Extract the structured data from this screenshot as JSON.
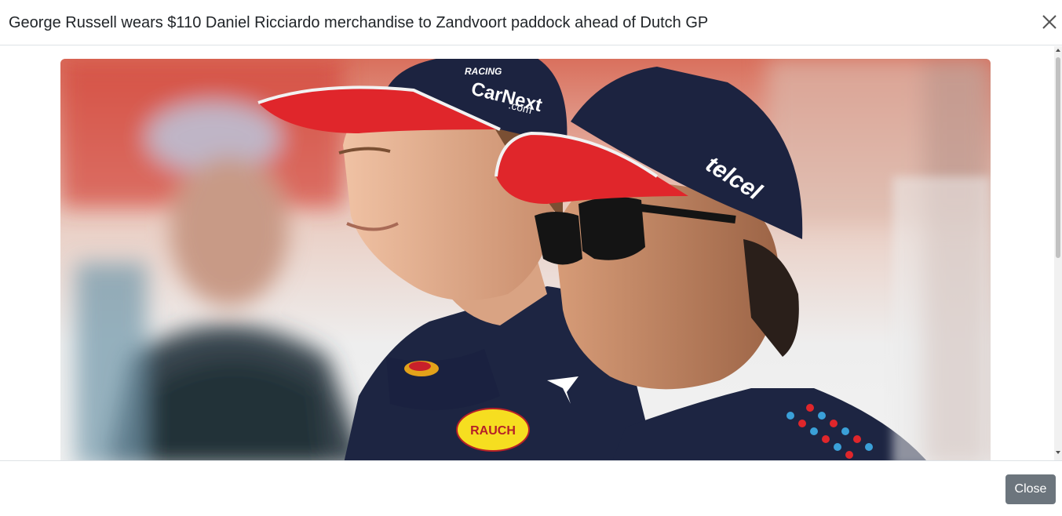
{
  "modal": {
    "title": "George Russell wears $110 Daniel Ricciardo merchandise to Zandvoort paddock ahead of Dutch GP",
    "close_icon": "close-icon",
    "footer": {
      "close_label": "Close"
    }
  },
  "photo": {
    "cap_brand_left": "CarNext",
    "cap_brand_left_sub": ".com",
    "cap_brand_right": "telcel",
    "racing_text": "RACING",
    "suit_sponsor": "RAUCH"
  },
  "colors": {
    "button_secondary": "#6c757d",
    "cap_navy": "#1c2340",
    "cap_visor_red": "#e0262b"
  }
}
